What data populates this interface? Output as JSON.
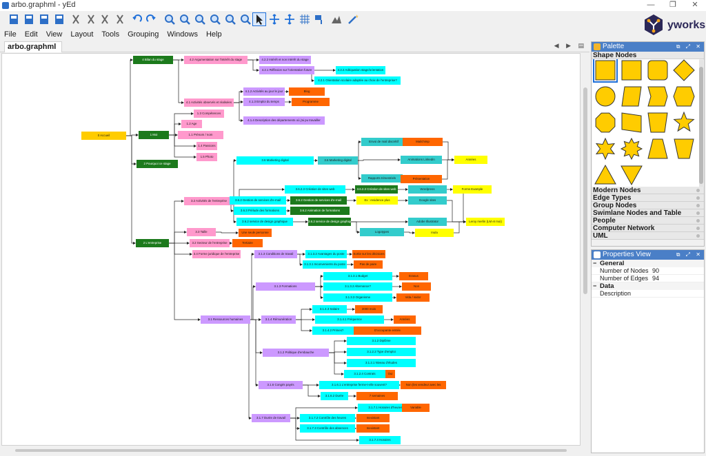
{
  "window": {
    "title": "arbo.graphml - yEd",
    "controls": [
      "—",
      "❐",
      "✕"
    ]
  },
  "logo": {
    "name": "yworks"
  },
  "menu": [
    "File",
    "Edit",
    "View",
    "Layout",
    "Tools",
    "Grouping",
    "Windows",
    "Help"
  ],
  "toolbar_icons": [
    "new-document-icon",
    "open-folder-icon",
    "save-icon",
    "print-icon",
    "cut-icon",
    "copy-icon",
    "paste-icon",
    "delete-icon",
    "undo-icon",
    "redo-icon",
    "zoom-in-icon",
    "zoom-out-icon",
    "zoom-fit-icon",
    "zoom-original-icon",
    "zoom-selection-icon",
    "fit-content-icon",
    "edit-mode-icon",
    "pan-mode-icon",
    "move-icon",
    "grid-icon",
    "snap-lines-icon",
    "layout-icon",
    "magic-wand-icon"
  ],
  "document": {
    "tab": "arbo.graphml *",
    "close": "x"
  },
  "graph_nodes": {
    "root": "0 Accueil",
    "n4": "4 Bilan du stage",
    "n42": "4.2 Argumentation sur l'intérêt du stage",
    "n422": "4.2.2 Intérêt et non intérêt du stage",
    "n421": "4.2.1 Réflexion sur l'orientation future",
    "n4212": "4.2.2 Adéquation stage/orientation",
    "n4211": "4.2.1 Orientation scolaire adaptée au choix de l'entreprise?",
    "n41": "4.1 Activités observés et réalisées",
    "n412": "4.1.2 Activités au jour le jour",
    "n412v": "Blog",
    "n413": "4.1.3 Emploi du temps",
    "n413v": "Programme",
    "n414": "4.1.4 Description des départements où j'ai pu travailler",
    "n1": "1 Moi",
    "n13": "1.3 Compétences",
    "n12": "1.2 Age",
    "n11": "1.1 Prénom / nom",
    "n14": "1.4 Passions",
    "n15": "1.5 Photo",
    "n2a": "2 Pourquoi ce stage",
    "n36": "3.6 Marketing digital",
    "n36b": "3.6 Marketing digital",
    "n361": "Envoi de mail discrétif",
    "n361v": "Mailchimp",
    "n362": "Animations Linkedin",
    "n363": "Rapports trimestriels",
    "n363v": "Présentation",
    "n36r": "Années",
    "n32": "3.2 Activités de l'entreprise",
    "n323": "3.6.2.3 Création de sites web",
    "n323b": "3.6.2.3 Création de sites web",
    "n323c": "Wordpress",
    "n323d": "Forms Example",
    "n322": "3.6.2 Gestion de services d'e-mail",
    "n322b": "3.6.2 Gestion de services d'e-mail",
    "n322c": "Ex : residence plus",
    "n322d": "Google sites",
    "n324": "3.6.3 Prélude des formations",
    "n324b": "3.6.2 Animation de formations",
    "n325": "3.6.2 service de design graphique",
    "n325b": "3.6.2 service de design graphique",
    "n325c": "Adobe Illustrator",
    "n325d": "Logotypes",
    "n325e": "Inula",
    "n32r": "Leroy merlin (LM et moi)",
    "n33": "3.3 Taille",
    "n33v": "Une seule personne",
    "n332": "3.2 Secteur de l'entreprise",
    "n332v": "Tertiaire",
    "n334": "3.4 Forme juridique de l'entreprise",
    "n2": "2 L'entreprise",
    "n313": "3.1.3 Conditions de travail",
    "n3131": "3.1.3.2 Avantages du poste",
    "n3131v": "Sortie sur les décisions",
    "n3132": "3.1.3.1 Inconvenients du poste",
    "n3132v": "Pas de paire",
    "n3133": "3.1.3.1 Budget",
    "n3133v": "Erasus",
    "n3134": "3.1.3.2 Alternance?",
    "n3134v": "Non",
    "n3135": "3.1.3.3 Organisme",
    "n3135v": "Vida / isidor",
    "n31f": "3.1.3 Formations",
    "n314": "3.1.4 Rémunération",
    "n3141": "3.1.4.3 Salaire",
    "n3141v": "2000 mois",
    "n3142": "3.1.4.1 Fréquence",
    "n3142v": "Années",
    "n3143": "3.1.4.2 Primes?",
    "n3143v": "D'occupante entrée",
    "n31": "3.1 Ressources humaines",
    "n312": "3.1.2 Politique d'embauche",
    "n3121": "3.1.2 Diplôme",
    "n3122": "3.1.2.2 Type d'emploi",
    "n3123": "3.1.2.1 Niveau d'études",
    "n3124": "3.1.2.4 Contrats",
    "n3124v": "Oui",
    "n316": "3.1.6 Congés payés",
    "n3161": "3.1.6.1 L'entreprise ferme-t-elle souvent?",
    "n3161v": "Non (les vendeur avec les",
    "n3162": "3.1.6.2 Durée",
    "n3162v": "7 semaines",
    "n317": "3.1.7 Durée de travail",
    "n3171": "3.1.7.1 Horaires d'heures",
    "n3171v": "Variable",
    "n3172": "3.1.7.2 Contrôle des heures",
    "n3172v": "Inexistant",
    "n3173": "3.1.7.3 Contrôle des absences",
    "n3173v": "Inexistant",
    "n3174": "3.1.7.4 Horaires"
  },
  "palette": {
    "title": "Palette",
    "sections": [
      "Shape Nodes",
      "Modern Nodes",
      "Edge Types",
      "Group Nodes",
      "Swimlane Nodes and Table Nodes",
      "People",
      "Computer Network",
      "UML"
    ],
    "shape_color": "#ffcc00"
  },
  "properties": {
    "title": "Properties View",
    "general": "General",
    "rows": [
      {
        "key": "Number of Nodes",
        "value": "90"
      },
      {
        "key": "Number of Edges",
        "value": "94"
      }
    ],
    "data": "Data",
    "description": "Description"
  }
}
